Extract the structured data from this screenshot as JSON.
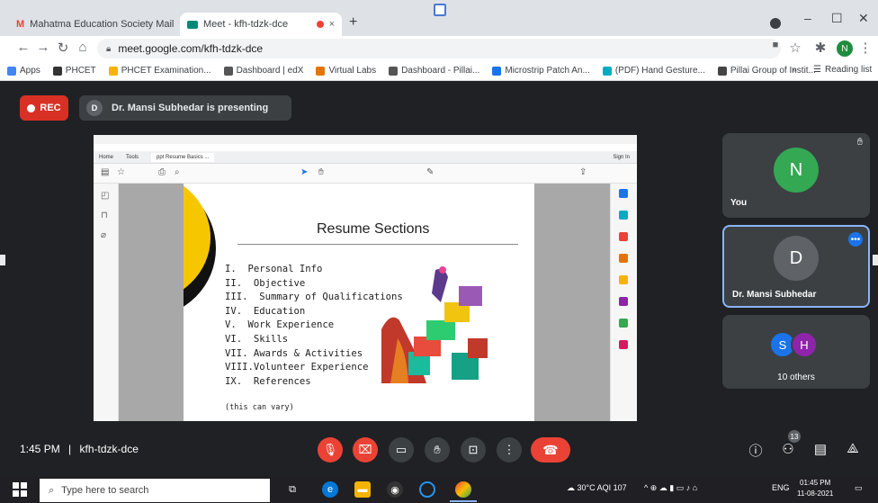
{
  "browser": {
    "tabs": [
      {
        "title": "Mahatma Education Society Mail",
        "close": "×"
      },
      {
        "title": "Meet - kfh-tdzk-dce",
        "close": "×"
      }
    ],
    "new_tab": "+",
    "window_controls": {
      "minimize": "–",
      "maximize": "☐",
      "close": "✕"
    },
    "address": "meet.google.com/kfh-tdzk-dce",
    "profile_initial": "N",
    "bookmarks": [
      {
        "label": "Apps",
        "color": "#4285f4"
      },
      {
        "label": "PHCET",
        "color": "#333333"
      },
      {
        "label": "PHCET Examination...",
        "color": "#f4b400"
      },
      {
        "label": "Dashboard | edX",
        "color": "#555555"
      },
      {
        "label": "Virtual Labs",
        "color": "#e37400"
      },
      {
        "label": "Dashboard - Pillai...",
        "color": "#555555"
      },
      {
        "label": "Microstrip Patch An...",
        "color": "#1a73e8"
      },
      {
        "label": "(PDF) Hand Gesture...",
        "color": "#00acc1"
      },
      {
        "label": "Pillai Group of Instit...",
        "color": "#444444"
      }
    ],
    "bookmarks_more": "»",
    "reading_list": "Reading list"
  },
  "meet": {
    "rec_label": "REC",
    "presenter_initial": "D",
    "presenting_text": "Dr. Mansi Subhedar is presenting",
    "meeting_time": "1:45 PM",
    "meeting_code": "kfh-tdzk-dce",
    "participant_count": "13",
    "tiles": {
      "you": {
        "initial": "N",
        "name": "You",
        "color": "#34a853"
      },
      "presenter": {
        "initial": "D",
        "name": "Dr. Mansi Subhedar",
        "color": "#5f6368"
      },
      "others": {
        "initials": [
          "S",
          "H"
        ],
        "colors": [
          "#1a73e8",
          "#8e24aa"
        ],
        "label": "10 others"
      }
    }
  },
  "shared_screen": {
    "pdf_tabs": [
      "Home",
      "Tools",
      "ppt Resume Basics ..."
    ],
    "pdf_sign_in": "Sign In",
    "slide_title": "Resume Sections",
    "sections": [
      "I.  Personal Info",
      "II.  Objective",
      "III.  Summary of Qualifications",
      "IV.  Education",
      "V.  Work Experience",
      "VI.  Skills",
      "VII. Awards & Activities",
      "VIII.Volunteer Experience",
      "IX.  References"
    ],
    "note": "(this can vary)"
  },
  "taskbar": {
    "search_placeholder": "Type here to search",
    "weather": "30°C  AQI 107",
    "lang": "ENG",
    "time": "01:45 PM",
    "date": "11-08-2021"
  }
}
